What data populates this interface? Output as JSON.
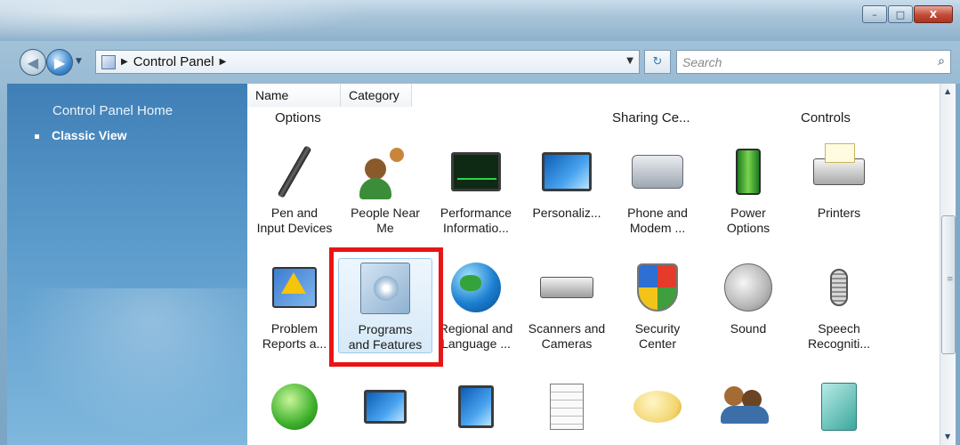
{
  "window": {
    "caption_buttons": {
      "minimize": "–",
      "maximize": "□",
      "close": "X"
    }
  },
  "address": {
    "back_icon": "back-arrow-icon",
    "forward_icon": "forward-arrow-icon",
    "breadcrumb": "Control Panel",
    "search_placeholder": "Search"
  },
  "left_pane": {
    "home_link": "Control Panel Home",
    "classic_view": "Classic View"
  },
  "columns": {
    "name": "Name",
    "category": "Category"
  },
  "top_row_labels": [
    "Options",
    "Sharing Ce...",
    "Controls"
  ],
  "rows": [
    [
      {
        "label": "Pen and\nInput Devices",
        "icon": "pen-icon"
      },
      {
        "label": "People Near\nMe",
        "icon": "people-near-me-icon"
      },
      {
        "label": "Performance\nInformatio...",
        "icon": "performance-monitor-icon"
      },
      {
        "label": "Personaliz...",
        "icon": "personalization-icon"
      },
      {
        "label": "Phone and\nModem ...",
        "icon": "phone-modem-icon"
      },
      {
        "label": "Power\nOptions",
        "icon": "power-battery-icon"
      },
      {
        "label": "Printers",
        "icon": "printer-icon"
      }
    ],
    [
      {
        "label": "Problem\nReports a...",
        "icon": "problem-reports-icon"
      },
      {
        "label": "Programs\nand Features",
        "icon": "programs-features-icon"
      },
      {
        "label": "Regional and\nLanguage ...",
        "icon": "regional-globe-icon"
      },
      {
        "label": "Scanners and\nCameras",
        "icon": "scanner-camera-icon"
      },
      {
        "label": "Security\nCenter",
        "icon": "security-shield-icon"
      },
      {
        "label": "Sound",
        "icon": "speaker-icon"
      },
      {
        "label": "Speech\nRecogniti...",
        "icon": "microphone-icon"
      }
    ]
  ],
  "third_row_icons": [
    "sync-center-icon",
    "system-icon",
    "tablet-pc-icon",
    "taskbar-icon",
    "text-to-speech-icon",
    "user-accounts-icon",
    "welcome-center-icon"
  ],
  "highlighted_item": "Programs and Features",
  "colors": {
    "highlight_box": "#e81515",
    "left_pane": "#4a8cc0"
  }
}
